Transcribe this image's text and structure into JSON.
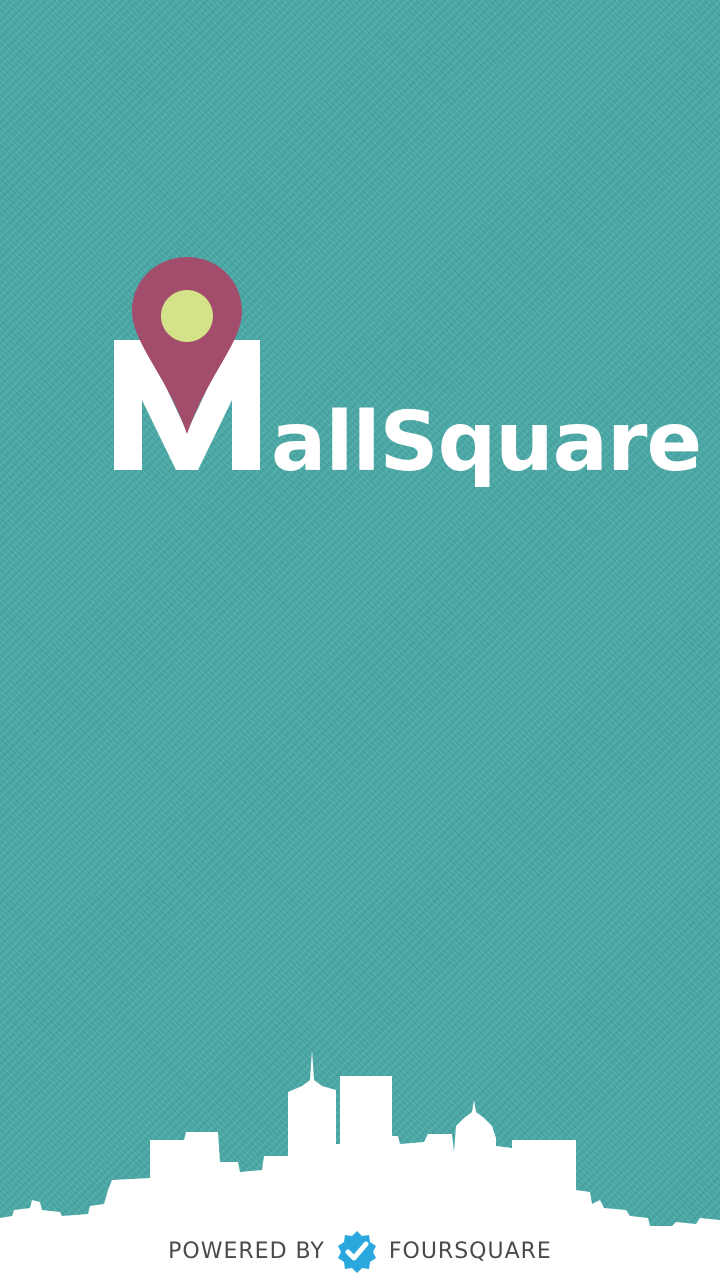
{
  "app": {
    "logo": {
      "initial": "M",
      "rest": "allSquare",
      "pin_icon": "map-pin-icon",
      "pin_color": "#a34d6d",
      "pin_dot_color": "#d4e38a"
    },
    "background_color": "#49a9a6"
  },
  "footer": {
    "powered_by": "POWERED BY",
    "brand": "FOURSQUARE",
    "brand_icon": "foursquare-check-icon",
    "brand_icon_color": "#2aa8dd"
  }
}
